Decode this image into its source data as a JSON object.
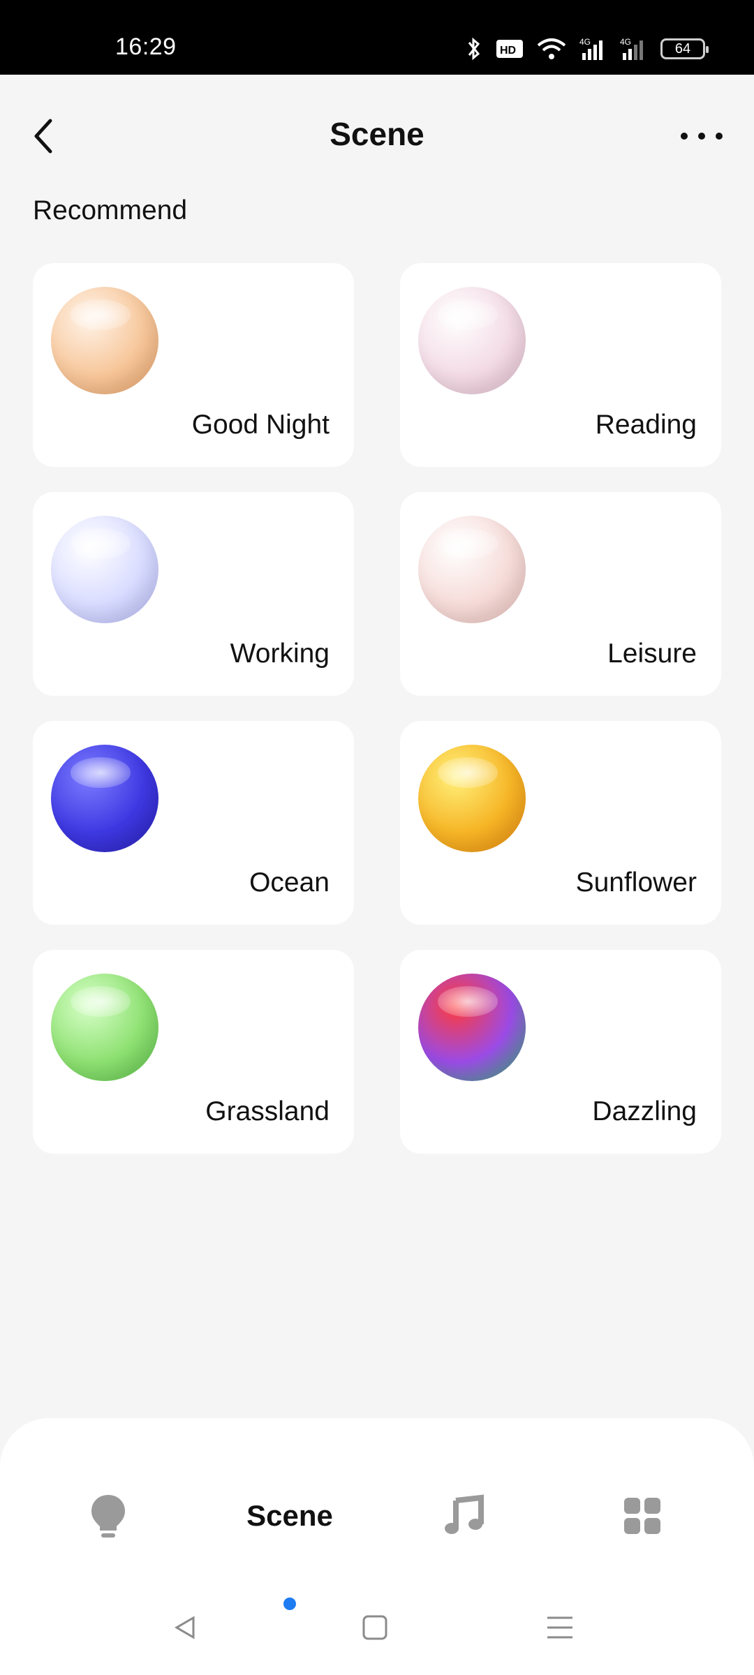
{
  "status_bar": {
    "time": "16:29",
    "battery": "64",
    "network_labels": [
      "4G",
      "4G"
    ]
  },
  "header": {
    "title": "Scene"
  },
  "section": {
    "title": "Recommend"
  },
  "scenes": [
    {
      "label": "Good Night",
      "orb_colors": [
        "#fff3e8",
        "#f7c79b",
        "#e9a36b"
      ]
    },
    {
      "label": "Reading",
      "orb_colors": [
        "#ffffff",
        "#f3dbe5",
        "#e2bfd0"
      ]
    },
    {
      "label": "Working",
      "orb_colors": [
        "#ffffff",
        "#d9dcff",
        "#b4b8f4"
      ]
    },
    {
      "label": "Leisure",
      "orb_colors": [
        "#ffffff",
        "#f6dcd9",
        "#e9bfba"
      ]
    },
    {
      "label": "Ocean",
      "orb_colors": [
        "#7c7cff",
        "#3e38e2",
        "#2a22b8"
      ]
    },
    {
      "label": "Sunflower",
      "orb_colors": [
        "#fff07a",
        "#f6b526",
        "#ea8a10"
      ]
    },
    {
      "label": "Grassland",
      "orb_colors": [
        "#d6ffc7",
        "#8fe173",
        "#5cc24a"
      ]
    },
    {
      "label": "Dazzling",
      "orb_colors": [
        "#ff3b3b",
        "#9b4be6",
        "#2fc070"
      ]
    }
  ],
  "bottom_nav": {
    "active_label": "Scene",
    "accent": "#1e7bf2",
    "items": [
      "bulb-icon",
      "scene-tab",
      "music-icon",
      "grid-icon"
    ]
  }
}
